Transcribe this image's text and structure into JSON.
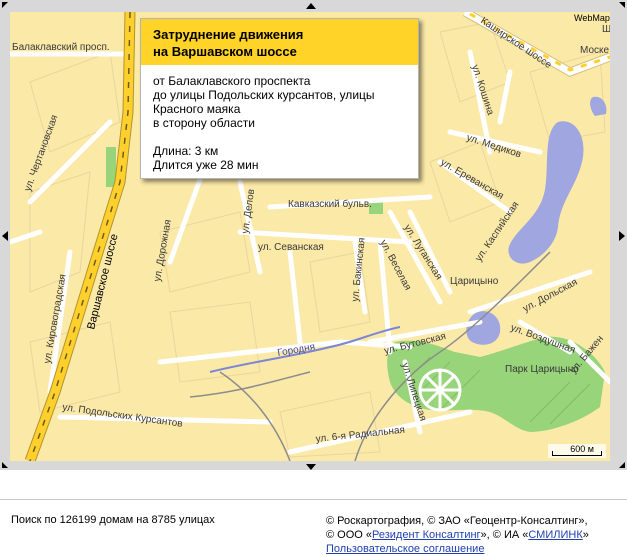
{
  "map": {
    "logo": "WebMap",
    "scale": "600 м",
    "colors": {
      "land": "#fbe9a8",
      "highway": "#ffd02c",
      "road": "#ffffff",
      "water": "#9fa6e0",
      "park": "#98d47a",
      "block_outline": "#e7d4a0"
    },
    "labels": {
      "balaklavsky": "Балаклавский просп.",
      "chertanovskaya": "ул. Чертановская",
      "varshavskoe": "Варшавское шоссе",
      "kirovogradskaya": "ул. Кировоградская",
      "dorozhnaya": "ул. Дорожная",
      "delovaya": "ул. Делов",
      "kavkazsky": "Кавказский бульв.",
      "sevanskaya": "ул. Севанская",
      "bakinskaya": "ул. Бакинская",
      "luganskaya": "ул. Луганская",
      "veselaya": "ул. Веселая",
      "kashirskoe": "Каширское шоссе",
      "kashirskoe_tail": "Ш",
      "moskvorechye": "Моске",
      "kashina": "ул. Кошина",
      "medikov": "ул. Медиков",
      "erevanskaya": "ул. Ереванская",
      "kaspiyskaya": "ул. Каспийская",
      "dolskaya": "ул. Дольская",
      "tsaritsyno": "Царицыно",
      "butovskaya": "ул. Бутовская",
      "vozdushnaya": "ул. Воздушная",
      "bazhenova": "ул. Бажен",
      "park": "Парк Царицыно",
      "lipetskaya": "ул. Липецкая",
      "gorodnya": "Городня",
      "podolskikh": "ул. Подольских Курсантов",
      "radialnaya": "ул. 6-я Радиальная"
    }
  },
  "popup": {
    "title_lines": [
      "Затруднение движения",
      "на Варшавском шоссе"
    ],
    "body_lines": [
      "от Балаклавского проспекта",
      "до улицы Подольских курсантов, улицы",
      "Красного маяка",
      "в сторону области",
      "",
      "Длина: 3 км",
      "Длится уже 28 мин"
    ]
  },
  "footer": {
    "search_stats": "Поиск по 126199 домам на 8785 улицах",
    "copyright_line1": "© Роскартография, © ЗАО «Геоцентр-Консалтинг»,",
    "copyright_line2_pre": "© ООО «",
    "copyright_link1": "Резидент Консалтинг",
    "copyright_line2_mid": "», © ИА «",
    "copyright_link2": "СМИЛИНК",
    "copyright_line2_post": "»",
    "agreement_link": "Пользовательское соглашение"
  }
}
